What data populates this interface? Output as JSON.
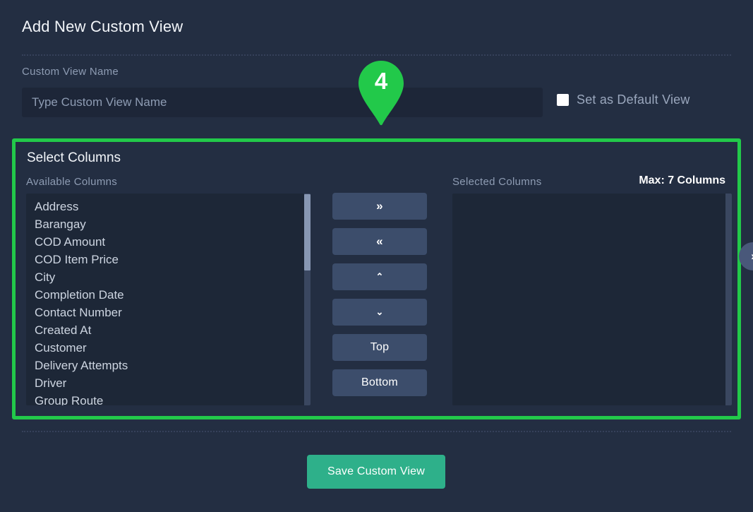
{
  "header": {
    "title": "Add New Custom View"
  },
  "form": {
    "name_label": "Custom View Name",
    "name_value": "",
    "name_placeholder": "Type Custom View Name",
    "default_view_label": "Set as Default View",
    "default_view_checked": false
  },
  "marker": {
    "number": "4",
    "color": "#22c94a"
  },
  "select_columns": {
    "title": "Select Columns",
    "highlight_color": "#22c94a",
    "available_label": "Available Columns",
    "selected_label": "Selected Columns",
    "max_columns_note": "Max: 7 Columns",
    "available_items": [
      "Address",
      "Barangay",
      "COD Amount",
      "COD Item Price",
      "City",
      "Completion Date",
      "Contact Number",
      "Created At",
      "Customer",
      "Delivery Attempts",
      "Driver",
      "Group Route"
    ],
    "selected_items": [],
    "transfer_buttons": [
      {
        "name": "move-right",
        "label": "»"
      },
      {
        "name": "move-left",
        "label": "«"
      },
      {
        "name": "move-up",
        "label": "⌃"
      },
      {
        "name": "move-down",
        "label": "⌄"
      },
      {
        "name": "move-top",
        "label": "Top"
      },
      {
        "name": "move-bottom",
        "label": "Bottom"
      }
    ]
  },
  "edge_nav": {
    "label": "›"
  },
  "footer": {
    "save_label": "Save Custom View",
    "save_color": "#2eb08a"
  }
}
